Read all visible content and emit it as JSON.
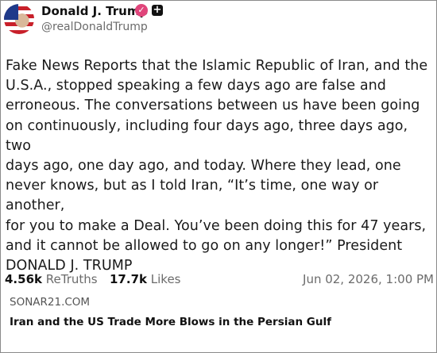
{
  "post": {
    "author_name": "Donald J. Trump",
    "handle": "@realDonaldTrump",
    "verified_icon": "check-badge-icon",
    "plus_icon": "plus-square-icon",
    "text_lines": [
      "Fake News Reports that the Islamic Republic of Iran, and the",
      "U.S.A., stopped speaking a few days ago are false and",
      "erroneous. The conversations between us have been going",
      "on continuously, including four days ago, three days ago, two",
      "days ago, one day ago, and today. Where they lead, one",
      "never knows, but as I told Iran, “It’s time, one way or another,",
      "for you to make a Deal. You’ve been doing this for 47 years,",
      "and it cannot be allowed to go on any longer!” President",
      "DONALD J. TRUMP"
    ],
    "retruths_count": "4.56k",
    "retruths_label": "ReTruths",
    "likes_count": "17.7k",
    "likes_label": "Likes",
    "timestamp": "Jun 02, 2026, 1:00 PM"
  },
  "footer": {
    "source": "SONAR21.COM",
    "headline": "Iran and the US Trade More Blows in the Persian Gulf"
  },
  "colors": {
    "verified": "#e0457b",
    "muted_text": "#6b6b6b",
    "border": "#8a8a8a"
  }
}
